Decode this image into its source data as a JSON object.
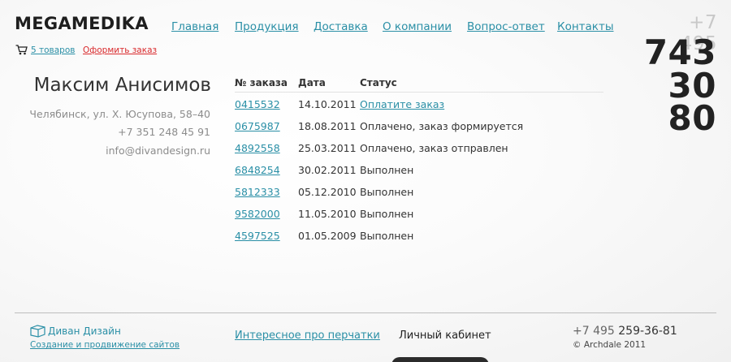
{
  "header": {
    "logo": "MEGAMEDIKA",
    "nav": [
      {
        "label": "Главная"
      },
      {
        "label": "Продукция"
      },
      {
        "label": "Доставка"
      },
      {
        "label": "О компании"
      },
      {
        "label": "Вопрос-ответ"
      },
      {
        "label": "Контакты"
      }
    ],
    "cart_count": "5 товаров",
    "checkout_label": "Оформить заказ",
    "phone_prefix": "+7 495",
    "phone_parts": [
      "743",
      "30",
      "80"
    ]
  },
  "profile": {
    "name": "Максим Анисимов",
    "address": "Челябинск, ул. Х. Юсупова, 58–40",
    "phone": "+7 351 248 45 91",
    "email": "info@divandesign.ru"
  },
  "orders": {
    "headers": {
      "number": "№ заказа",
      "date": "Дата",
      "status": "Статус"
    },
    "rows": [
      {
        "number": "0415532",
        "date": "14.10.2011",
        "status": "Оплатите заказ"
      },
      {
        "number": "0675987",
        "date": "18.08.2011",
        "status": "Оплачено, заказ формируется"
      },
      {
        "number": "4892558",
        "date": "25.03.2011",
        "status": "Оплачено, заказ отправлен"
      },
      {
        "number": "6848254",
        "date": "30.02.2011",
        "status": "Выполнен"
      },
      {
        "number": "5812333",
        "date": "05.12.2010",
        "status": "Выполнен"
      },
      {
        "number": "9582000",
        "date": "11.05.2010",
        "status": "Выполнен"
      },
      {
        "number": "4597525",
        "date": "01.05.2009",
        "status": "Выполнен"
      }
    ]
  },
  "footer": {
    "studio_name": "Диван Дизайн",
    "studio_tagline": "Создание и продвижение сайтов",
    "link": "Интересное про перчатки",
    "account": "Личный кабинет",
    "phone_prefix": "+7 495",
    "phone_number": "259-36-81",
    "copyright": "© Archdale 2011"
  },
  "colors": {
    "link": "#2a8fa6",
    "accent_red": "#d9292c",
    "text": "#333333"
  },
  "icons": {
    "cart": "cart-icon",
    "studio_logo": "sofa-logo-icon"
  }
}
